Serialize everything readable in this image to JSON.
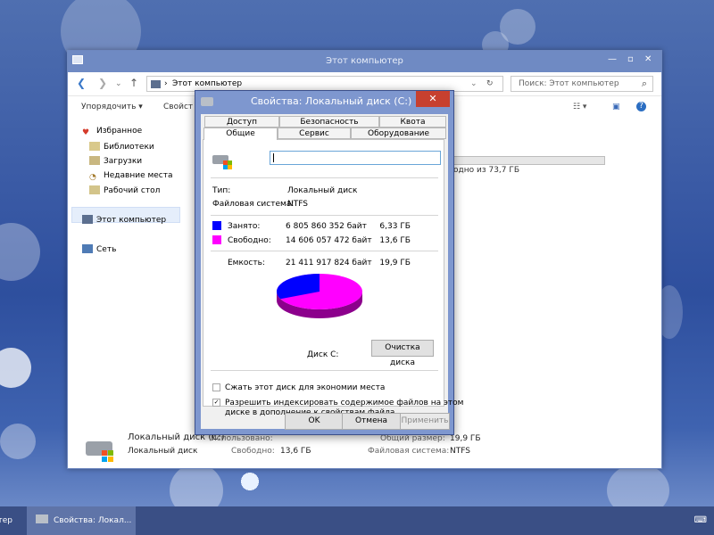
{
  "explorer": {
    "title": "Этот компьютер",
    "breadcrumb": "Этот компьютер",
    "search_placeholder": "Поиск: Этот компьютер",
    "toolbar": {
      "organize": "Упорядочить ▾",
      "properties": "Свойст"
    },
    "nav": {
      "favorites": "Избранное",
      "libraries": "Библиотеки",
      "downloads": "Загрузки",
      "recent": "Недавние места",
      "desktop": "Рабочий стол",
      "this_pc": "Этот компьютер",
      "network": "Сеть"
    },
    "capacity_text": "одно из 73,7 ГБ",
    "details": {
      "name": "Локальный диск (C:)",
      "type": "Локальный диск",
      "used_label": "Использовано:",
      "free_label": "Свободно:",
      "free_value": "13,6 ГБ",
      "total_label": "Общий размер:",
      "total_value": "19,9 ГБ",
      "fs_label": "Файловая система:",
      "fs_value": "NTFS"
    }
  },
  "dialog": {
    "title": "Свойства: Локальный диск (C:)",
    "tabs_row1": [
      "Доступ",
      "Безопасность",
      "Квота"
    ],
    "tabs_row2": [
      "Общие",
      "Сервис",
      "Оборудование"
    ],
    "name_value": "",
    "type_label": "Тип:",
    "type_value": "Локальный диск",
    "fs_label": "Файловая система:",
    "fs_value": "NTFS",
    "used": {
      "label": "Занято:",
      "bytes": "6 805 860 352 байт",
      "gb": "6,33 ГБ",
      "color": "#0000ff"
    },
    "free": {
      "label": "Свободно:",
      "bytes": "14 606 057 472 байт",
      "gb": "13,6 ГБ",
      "color": "#ff00ff"
    },
    "capacity": {
      "label": "Емкость:",
      "bytes": "21 411 917 824 байт",
      "gb": "19,9 ГБ"
    },
    "disk_label": "Диск C:",
    "cleanup_button": "Очистка диска",
    "compress_label": "Сжать этот диск для экономии места",
    "compress_checked": false,
    "index_label_line1": "Разрешить индексировать содержимое файлов на этом",
    "index_label_line2": "диске в дополнение к свойствам файла",
    "index_checked": true,
    "buttons": {
      "ok": "OK",
      "cancel": "Отмена",
      "apply": "Применить"
    }
  },
  "taskbar": {
    "left_stub": "отер",
    "task_label": "Свойства: Локал..."
  }
}
